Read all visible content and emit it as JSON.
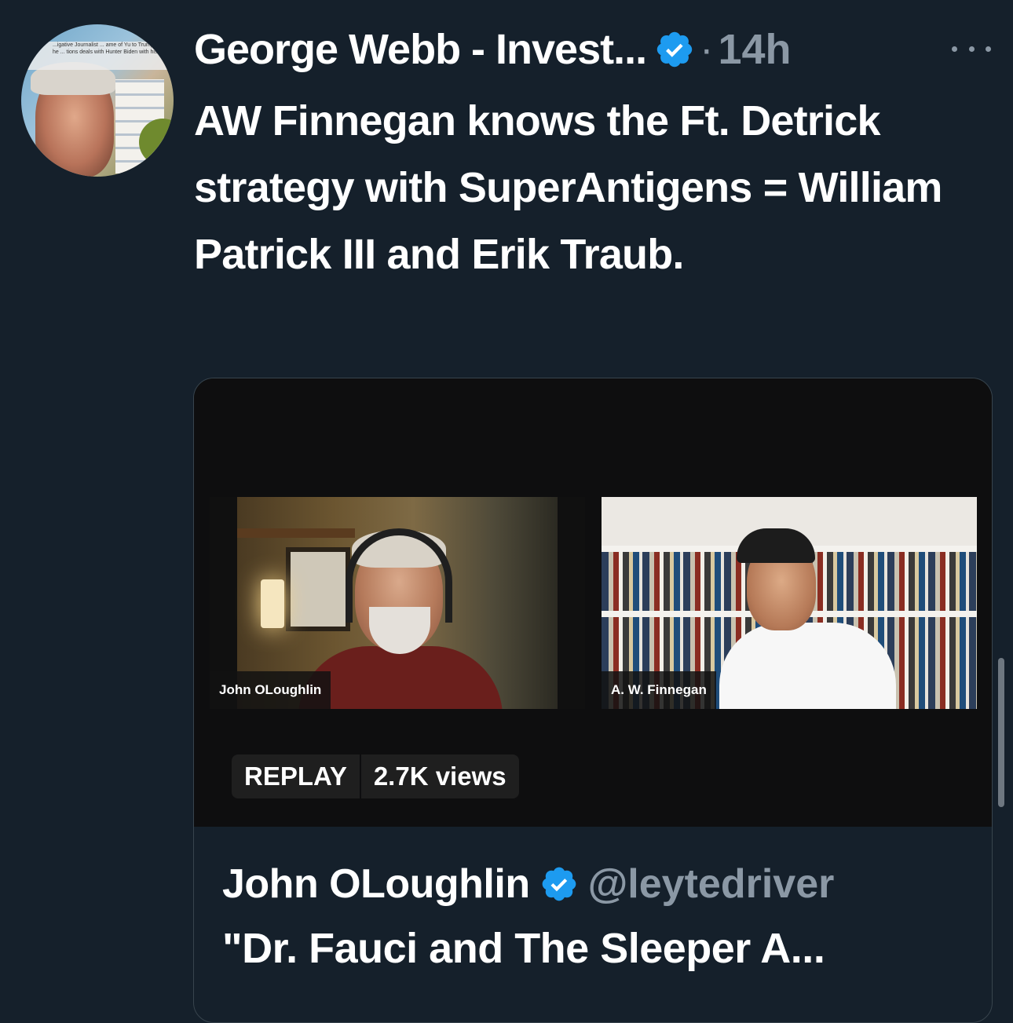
{
  "tweet": {
    "author_name": "George Webb - Invest...",
    "separator": "·",
    "time": "14h",
    "text": "AW Finnegan knows the Ft. Detrick strategy with SuperAntigens = William Patrick III and Erik Traub.",
    "avatar_banner": "...igative Journalist ... ame of Yu to Trump? Didn't he ... tions deals with Hunter Biden with his ..."
  },
  "card": {
    "participants": [
      {
        "name": "John OLoughlin"
      },
      {
        "name": "A. W. Finnegan"
      }
    ],
    "replay_label": "REPLAY",
    "views": "2.7K views",
    "author_name": "John OLoughlin",
    "handle": "@leytedriver",
    "title": "\"Dr. Fauci and The Sleeper A..."
  },
  "colors": {
    "background": "#15202b",
    "text_primary": "#ffffff",
    "text_secondary": "#8b98a5",
    "verified_blue": "#1d9bf0",
    "card_border": "#38444d",
    "video_bg": "#0e0e0f"
  },
  "icons": {
    "verified": "verified-badge-icon",
    "more": "more-horizontal-icon"
  }
}
